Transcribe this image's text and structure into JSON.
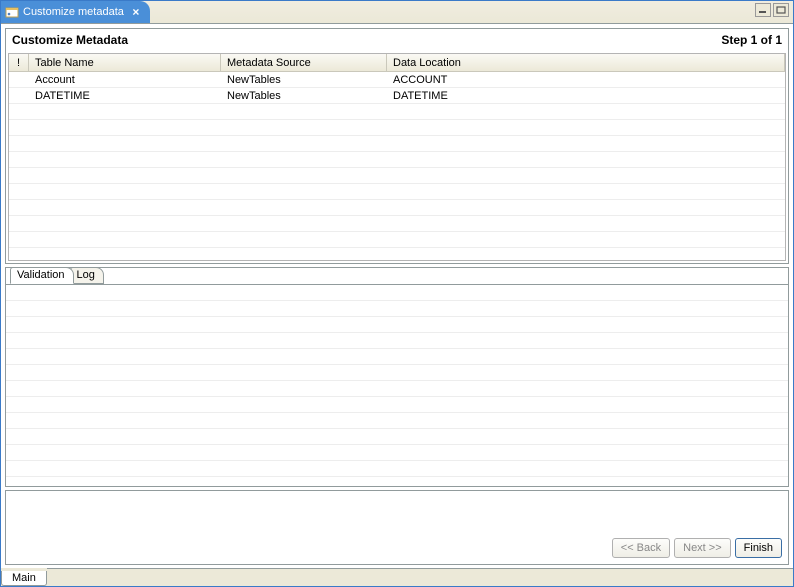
{
  "window": {
    "title": "Customize metadata"
  },
  "header": {
    "title": "Customize Metadata",
    "step": "Step 1 of 1"
  },
  "table": {
    "columns": {
      "exclaim": "!",
      "name": "Table Name",
      "source": "Metadata Source",
      "location": "Data Location"
    },
    "rows": [
      {
        "name": "Account",
        "source": "NewTables",
        "location": "ACCOUNT"
      },
      {
        "name": "DATETIME",
        "source": "NewTables",
        "location": "DATETIME"
      }
    ]
  },
  "tabs": {
    "validation": "Validation",
    "log": "Log"
  },
  "buttons": {
    "back": "<< Back",
    "next": "Next >>",
    "finish": "Finish"
  },
  "bottomTab": "Main"
}
